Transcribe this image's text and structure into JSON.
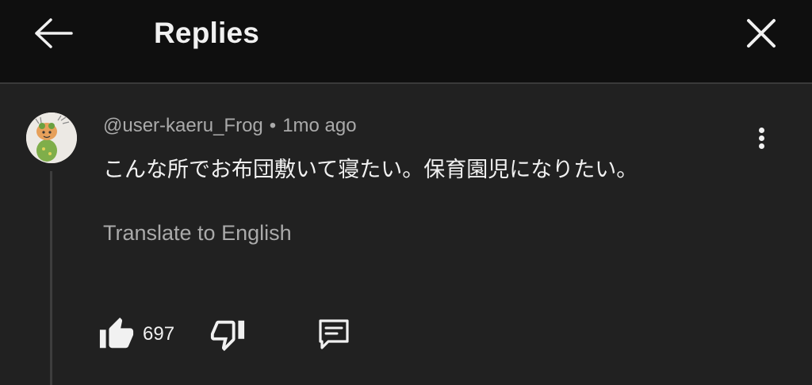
{
  "header": {
    "title": "Replies",
    "back_icon": "arrow-back-icon",
    "close_icon": "close-icon"
  },
  "comment": {
    "author": "@user-kaeru_Frog",
    "separator": "•",
    "timestamp": "1mo ago",
    "text": "こんな所でお布団敷いて寝たい。保育園児になりたい。",
    "translate_label": "Translate to English",
    "like_count": "697",
    "icons": {
      "more": "more-vert-icon",
      "like": "thumb-up-icon",
      "dislike": "thumb-down-icon",
      "reply": "comment-reply-icon"
    }
  },
  "colors": {
    "header_bg": "#0f0f0f",
    "body_bg": "#212121",
    "primary_text": "#f1f1f1",
    "secondary_text": "#aaaaaa"
  }
}
